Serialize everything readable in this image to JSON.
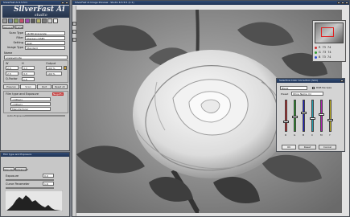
{
  "app": {
    "logo_title": "SilverFast Ai",
    "logo_subtitle": "studio",
    "left_window_title": "SilverFast Ai 6.5.5r1",
    "right_window_title": "SilverFast Ai Image Preview - Studio 6.5.5r1 (1:1)"
  },
  "left_panel": {
    "tabs": [
      "General",
      "Frame"
    ],
    "rows": [
      {
        "label": "Scan Type",
        "value": "16 Bit Grayscale"
      },
      {
        "label": "Filter",
        "value": "Sharpen (USM)"
      },
      {
        "label": "Setting",
        "value": "Scan"
      },
      {
        "label": "Image Type",
        "value": "Standard"
      }
    ],
    "name_label": "Name",
    "name_value": "Lowlevelnote",
    "size_labels": [
      "W",
      "H",
      "Output"
    ],
    "size_values": [
      "2.5",
      "3.3",
      "100 %"
    ],
    "q_label": "Q-Factor",
    "q_value": "1.5",
    "buttons": [
      "Prescan",
      "Scan",
      "Quit",
      "Reset All"
    ],
    "film_label": "Film type and Exposure",
    "film_badge": "NegaFix",
    "film_rows": [
      "<Other>",
      "<Other>",
      "Manufacturer"
    ],
    "auto_exposure": "Auto-Exposure",
    "tabs2": [
      "Standard",
      "Advanced"
    ],
    "exposure_label": "Exposure",
    "exposure_value": "0.0",
    "gamma_label": "Curve Parameter",
    "gamma_value": "1.6"
  },
  "navigator": {
    "readouts": [
      {
        "color": "#d23030",
        "name": "R",
        "v1": "73",
        "v2": "74"
      },
      {
        "color": "#2f9a2f",
        "name": "G",
        "v1": "73",
        "v2": "74"
      },
      {
        "color": "#2f4fd2",
        "name": "B",
        "v1": "73",
        "v2": "74"
      }
    ]
  },
  "dialog": {
    "title": "Selective Color Correction (SCC)",
    "preset_select": "Blank",
    "rgb_checkbox": "RGB Recipes",
    "color_label": "Preset",
    "color_select": "Ohne Name (1)",
    "sliders": [
      {
        "color": "#d02020",
        "value": 0.3,
        "letter": "R"
      },
      {
        "color": "#20a020",
        "value": 0.45,
        "letter": "G"
      },
      {
        "color": "#2020d0",
        "value": 0.6,
        "letter": "B"
      },
      {
        "color": "#20a0b0",
        "value": 0.4,
        "letter": "C"
      },
      {
        "color": "#b020b0",
        "value": 0.55,
        "letter": "M"
      },
      {
        "color": "#c0b020",
        "value": 0.35,
        "letter": "Y"
      }
    ],
    "ok_label": "OK",
    "reset_label": "Reset",
    "cancel_label": "Cancel"
  }
}
